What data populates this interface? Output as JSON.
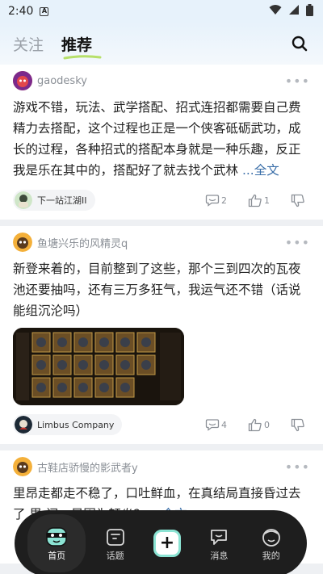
{
  "statusbar": {
    "time": "2:40",
    "notif_letter": "A"
  },
  "header": {
    "tab_follow": "关注",
    "tab_recommend": "推荐"
  },
  "posts": [
    {
      "username": "gaodesky",
      "text": "游戏不错，玩法、武学搭配、招式连招都需要自己费精力去搭配，这个过程也正是一个侠客砥砺武功，成长的过程，各种招式的搭配本身就是一种乐趣，反正我是乐在其中的，搭配好了就去找个武林",
      "full_label": "...全文",
      "topic": "下一站江湖II",
      "comments": "2",
      "likes": "1"
    },
    {
      "username": "鱼塘兴乐的风精灵q",
      "text": "新登来着的，目前整到了这些，那个三到四次的瓦夜池还要抽吗，还有三万多狂气，我运气还不错（话说能组沉沦吗）",
      "topic": "Limbus Company",
      "comments": "4",
      "likes": "0"
    },
    {
      "username": "古鞋店骄慢的影武者y",
      "text": "里昂走都走不稳了，口吐鲜血，在真结局直接昏过去了 里 问，是因为轩炎？",
      "full_label": "...全文"
    }
  ],
  "nav": {
    "home": "首页",
    "topics": "话题",
    "post": "+",
    "messages": "消息",
    "mine": "我的"
  },
  "colors": {
    "accent_green": "#b7e06a",
    "nav_bg": "#1e1e1e",
    "link": "#3a6ea8"
  }
}
